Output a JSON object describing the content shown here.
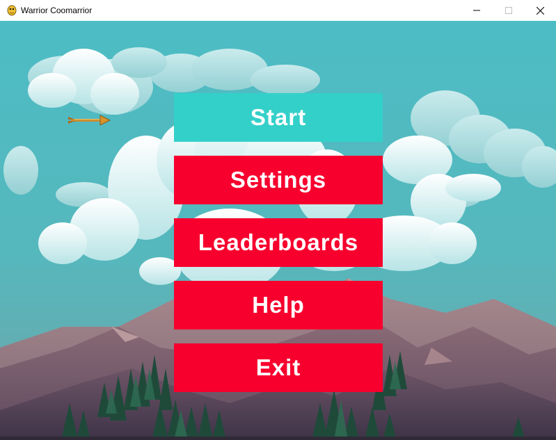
{
  "window": {
    "title": "Warrior Coomarrior",
    "app_icon": "pygame-snake-icon",
    "controls": [
      "minimize-icon",
      "maximize-icon",
      "close-icon"
    ]
  },
  "menu": {
    "start_label": "Start",
    "settings_label": "Settings",
    "leaderboards_label": "Leaderboards",
    "help_label": "Help",
    "exit_label": "Exit"
  },
  "colors": {
    "sky": "#4fbec5",
    "highlight_button": "#33d0c9",
    "button": "#f7002e",
    "button_text": "#ffffff"
  }
}
